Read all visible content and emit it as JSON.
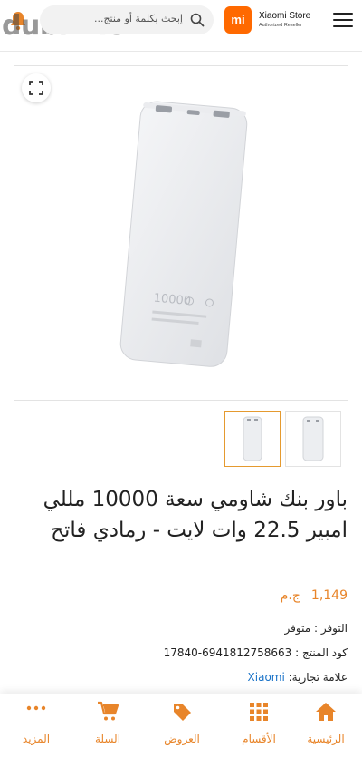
{
  "header": {
    "watermark_text": "dubizzle",
    "search_placeholder": "إبحث بكلمة أو منتج...",
    "logo_text": "mi",
    "store_name": "Xiaomi Store",
    "store_subtitle": "Authorized Reseller",
    "icons": [
      "bell-icon",
      "search-icon",
      "menu-icon"
    ]
  },
  "product": {
    "image_label": "10000",
    "title": "باور بنك شاومي سعة 10000 مللي امبير 22.5 وات لايت - رمادي فاتح",
    "price_value": "1,149",
    "currency": "ج.م",
    "availability_label": "التوفر :",
    "availability_value": "متوفر",
    "code_label": "كود المنتج :",
    "code_value": "17840-6941812758663",
    "brand_label": "علامة تجارية:",
    "brand_value": "Xiaomi"
  },
  "bottom_nav": {
    "items": [
      {
        "label": "الرئيسية",
        "icon": "home-icon"
      },
      {
        "label": "الأقسام",
        "icon": "grid-icon"
      },
      {
        "label": "العروض",
        "icon": "tag-icon"
      },
      {
        "label": "السلة",
        "icon": "cart-icon"
      },
      {
        "label": "المزيد",
        "icon": "more-icon"
      }
    ]
  },
  "colors": {
    "accent": "#e8852a",
    "brand_orange": "#ff6900",
    "link_blue": "#1a73c8"
  }
}
